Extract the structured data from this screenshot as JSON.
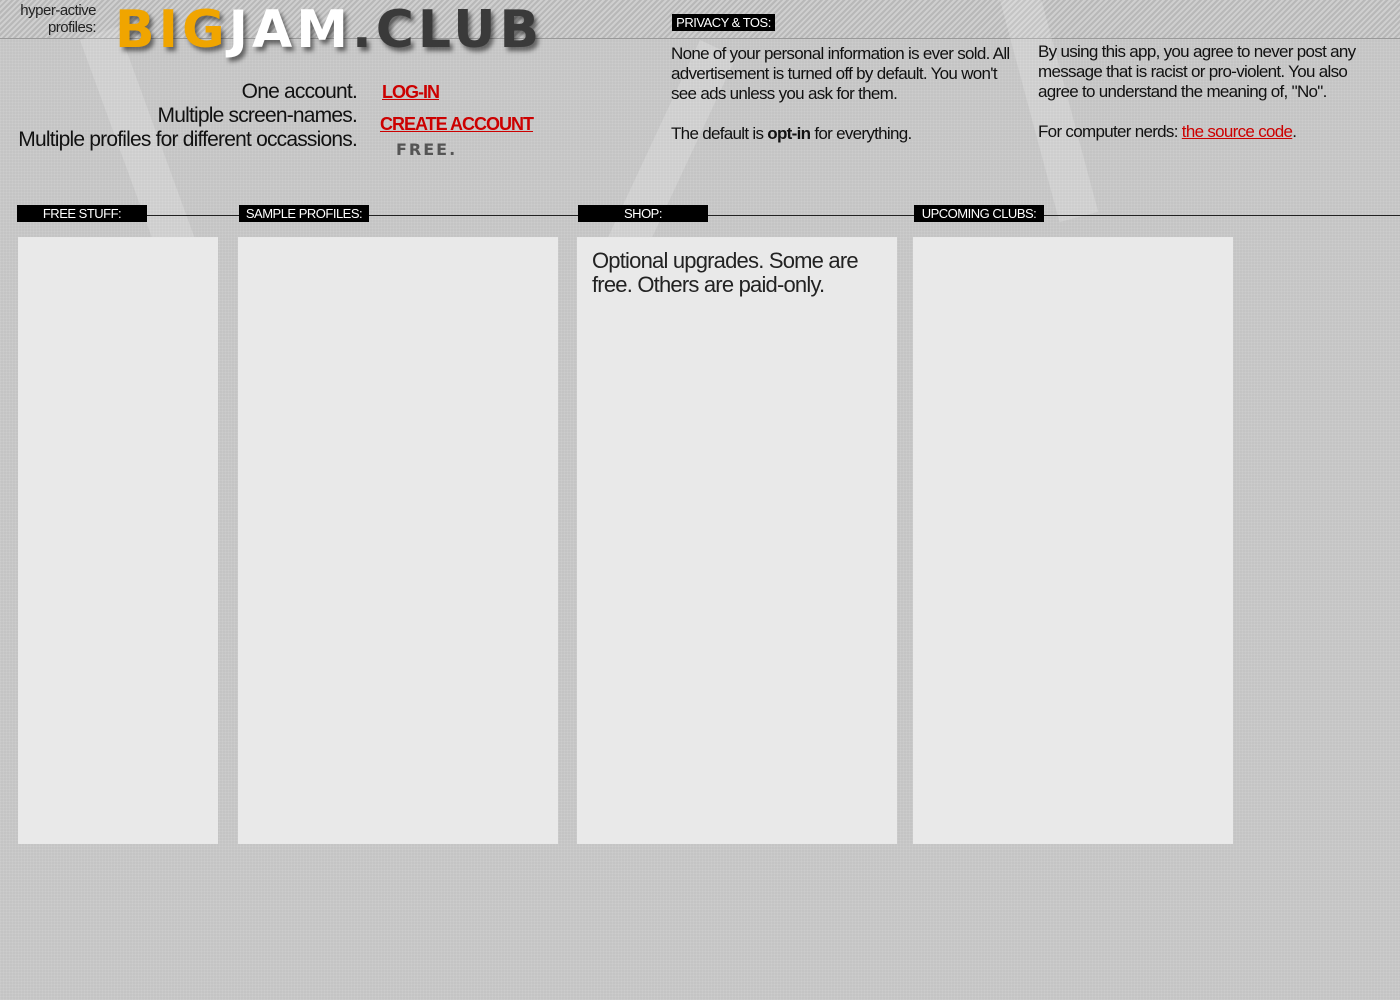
{
  "header": {
    "tagline": "hyper-active profiles:",
    "logo": {
      "part1": "BIG",
      "part2": "JAM",
      "part3": ".CLUB",
      "colors": [
        "#f0a500",
        "#ffffff",
        "#3a3a3a"
      ]
    },
    "pitch": [
      "One account.",
      "Multiple screen-names.",
      "Multiple profiles for different occassions."
    ],
    "login_label": "LOG-IN",
    "create_label": "CREATE ACCOUNT",
    "free_label": "FREE."
  },
  "privacy": {
    "title": "PRIVACY & TOS:",
    "p1": "None of your personal information is ever sold. All advertisement is turned off by default. You won't see ads unless you ask for them.",
    "p2_pre": "The default is ",
    "p2_bold": "opt-in",
    "p2_post": " for everything.",
    "p3": "By using this app, you agree to never post any message that is racist or pro-violent. You also agree to understand the meaning of, \"No\".",
    "p4_pre": "For computer nerds: ",
    "p4_link": "the source code",
    "p4_post": "."
  },
  "sections": {
    "free": {
      "title": "FREE STUFF:"
    },
    "samples": {
      "title": "SAMPLE PROFILES:"
    },
    "shop": {
      "title": "SHOP:",
      "text": "Optional upgrades. Some are free. Others are paid-only."
    },
    "clubs": {
      "title": "UPCOMING CLUBS:"
    }
  },
  "colors": {
    "link": "#cc0000",
    "accent": "#f0a500"
  }
}
